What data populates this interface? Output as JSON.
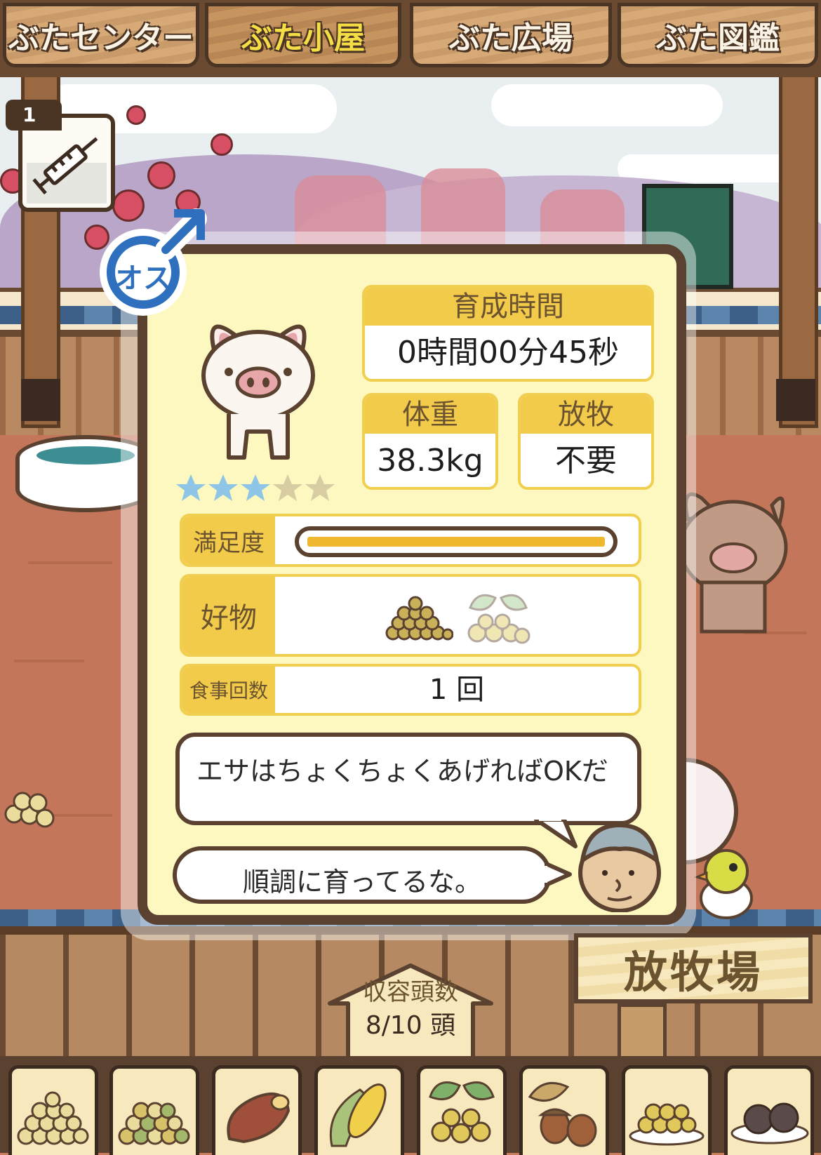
{
  "tabs": [
    {
      "label": "ぶたセンター",
      "active": false
    },
    {
      "label": "ぶた小屋",
      "active": true
    },
    {
      "label": "ぶた広場",
      "active": false
    },
    {
      "label": "ぶた図鑑",
      "active": false
    }
  ],
  "item": {
    "count": "1",
    "icon": "syringe-icon"
  },
  "pig": {
    "gender_label": "オス",
    "stars": {
      "filled": 3,
      "total": 5
    },
    "growth_time": {
      "label": "育成時間",
      "value": "0時間00分45秒"
    },
    "weight": {
      "label": "体重",
      "value": "38.3kg"
    },
    "grazing": {
      "label": "放牧",
      "value": "不要"
    },
    "satisfaction": {
      "label": "満足度",
      "level": 1.0
    },
    "favorite": {
      "label": "好物",
      "items": [
        "soybeans-icon",
        "mixed-beans-icon"
      ]
    },
    "meals": {
      "label": "食事回数",
      "value": "1 回"
    }
  },
  "speech": {
    "top": "エサはちょくちょくあげればOKだ",
    "bottom": "順調に育ってるな。"
  },
  "sign": {
    "label": "放牧場"
  },
  "capacity": {
    "label": "収容頭数",
    "value": "8/10 頭"
  },
  "food_bar": [
    "soybeans-icon",
    "mixed-beans-icon",
    "sweet-potato-icon",
    "corn-icon",
    "mixed-beans-leaf-icon",
    "acorn-icon",
    "beans-plate-icon",
    "dumplings-icon"
  ],
  "colors": {
    "accent_yellow": "#f3cb4a",
    "frame_brown": "#5a4130",
    "panel_bg": "#fdf7c0",
    "male_blue": "#2e6fbe"
  }
}
